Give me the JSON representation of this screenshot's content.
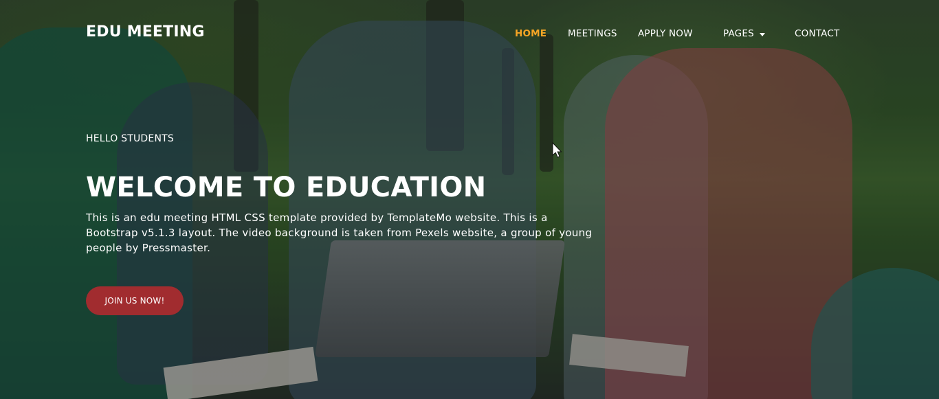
{
  "brand": {
    "name": "EDU MEETING"
  },
  "nav": {
    "items": [
      {
        "label": "HOME",
        "active": true
      },
      {
        "label": "MEETINGS"
      },
      {
        "label": "APPLY NOW"
      },
      {
        "label": "PAGES",
        "has_dropdown": true
      },
      {
        "label": "CONTACT"
      }
    ],
    "active_color": "#f5a425"
  },
  "hero": {
    "kicker": "HELLO STUDENTS",
    "title": "WELCOME TO EDUCATION",
    "description": "This is an edu meeting HTML CSS template provided by TemplateMo website. This is a Bootstrap v5.1.3 layout. The video background is taken from Pexels website, a group of young people by Pressmaster.",
    "cta_label": "JOIN US NOW!",
    "cta_color": "#a12c2f"
  },
  "icons": {
    "dropdown": "caret-down-icon",
    "cursor": "mouse-pointer-icon"
  }
}
